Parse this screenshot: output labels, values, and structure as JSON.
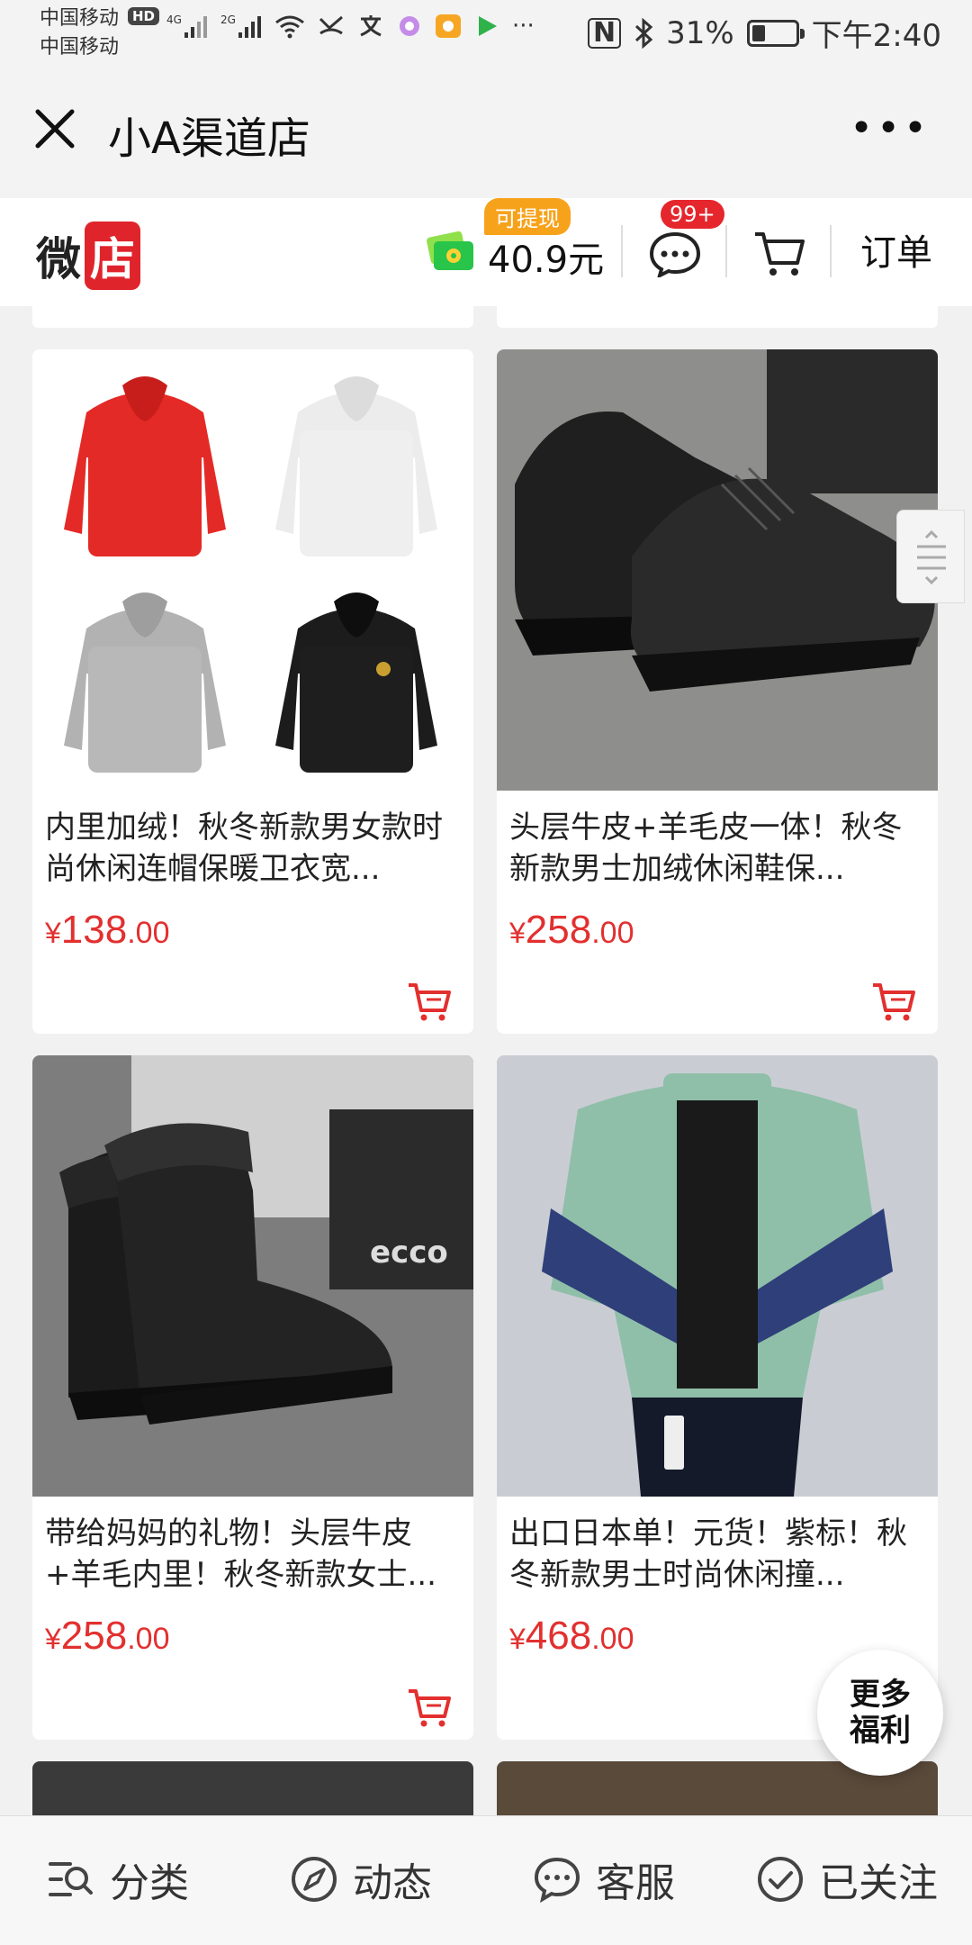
{
  "status_bar": {
    "carrier1": "中国移动",
    "hd": "HD",
    "carrier2": "中国移动",
    "signal_labels": [
      "4G",
      "2G"
    ],
    "battery_text": "31%",
    "battery_level": 0.31,
    "time": "下午2:40"
  },
  "titlebar": {
    "title": "小A渠道店"
  },
  "shop_header": {
    "logo_part1": "微",
    "logo_part2": "店",
    "withdraw_label": "可提现",
    "amount": "40.9元",
    "messages_badge": "99+",
    "orders_label": "订单"
  },
  "products": [
    {
      "name": "内里加绒！秋冬新款男女款时尚休闲连帽保暖卫衣宽...",
      "price_yen": "¥",
      "price_int": "138",
      "price_dec": ".00",
      "image": "hoodies"
    },
    {
      "name": "头层牛皮+羊毛皮一体！秋冬新款男士加绒休闲鞋保...",
      "price_yen": "¥",
      "price_int": "258",
      "price_dec": ".00",
      "image": "leather-shoes"
    },
    {
      "name": "带给妈妈的礼物！头层牛皮+羊毛内里！秋冬新款女士...",
      "price_yen": "¥",
      "price_int": "258",
      "price_dec": ".00",
      "image": "fur-boots"
    },
    {
      "name": "出口日本单！元货！紫标！秋冬新款男士时尚休闲撞...",
      "price_yen": "¥",
      "price_int": "468",
      "price_dec": ".00",
      "image": "down-jacket"
    }
  ],
  "product_images_text": {
    "ecco": "ecco"
  },
  "floating": {
    "more_benefits_line1": "更多",
    "more_benefits_line2": "福利"
  },
  "bottom_nav": [
    {
      "label": "分类",
      "icon": "category-search-icon"
    },
    {
      "label": "动态",
      "icon": "compass-icon"
    },
    {
      "label": "客服",
      "icon": "chat-icon"
    },
    {
      "label": "已关注",
      "icon": "check-circle-icon"
    }
  ],
  "colors": {
    "accent_red": "#e2302f",
    "badge_orange": "#f7a21b"
  }
}
